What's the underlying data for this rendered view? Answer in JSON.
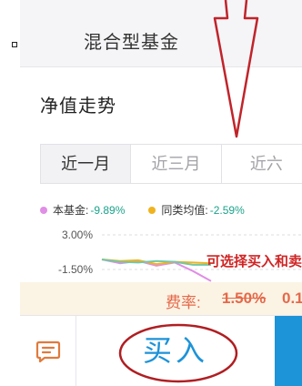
{
  "fund_type": {
    "label": "混合型基金"
  },
  "net_value": {
    "title": "净值走势"
  },
  "period_tabs": [
    {
      "label": "近一月",
      "active": true
    },
    {
      "label": "近三月",
      "active": false
    },
    {
      "label": "近六"
    }
  ],
  "legend": [
    {
      "name": "本基金:",
      "value": "-9.89%",
      "color": "#e08ee6"
    },
    {
      "name": "同类均值:",
      "value": "-2.59%",
      "color": "#f0b31e"
    }
  ],
  "annotation": {
    "text": "可选择买入和卖"
  },
  "fee": {
    "label": "费率:",
    "old_rate": "1.50%",
    "new_rate": "0.1"
  },
  "bottom": {
    "chat_icon": "chat-icon",
    "buy_label": "买入"
  },
  "colors": {
    "accent_blue": "#1d93d8",
    "annotation_red": "#d02424",
    "fee_orange": "#e5694a",
    "positive_green": "#1aa38a"
  },
  "chart_data": {
    "type": "line",
    "y_tick_labels": [
      "3.00%",
      "-1.50%"
    ],
    "ylim": [
      -1.5,
      3.0
    ],
    "series": [
      {
        "name": "本基金",
        "color": "#e08ee6",
        "values": [
          -0.2,
          -0.7,
          -0.4,
          -1.0,
          -0.6,
          -1.7,
          -3.0
        ]
      },
      {
        "name": "同类均值",
        "color": "#f0b31e",
        "values": [
          -0.2,
          -0.4,
          -0.3,
          -0.8,
          -0.5,
          -0.6,
          -0.7
        ]
      },
      {
        "color": "#73c8a6",
        "values": [
          -0.2,
          -0.5,
          -0.6,
          -0.4,
          -0.5,
          -0.9,
          -0.9
        ]
      }
    ]
  }
}
